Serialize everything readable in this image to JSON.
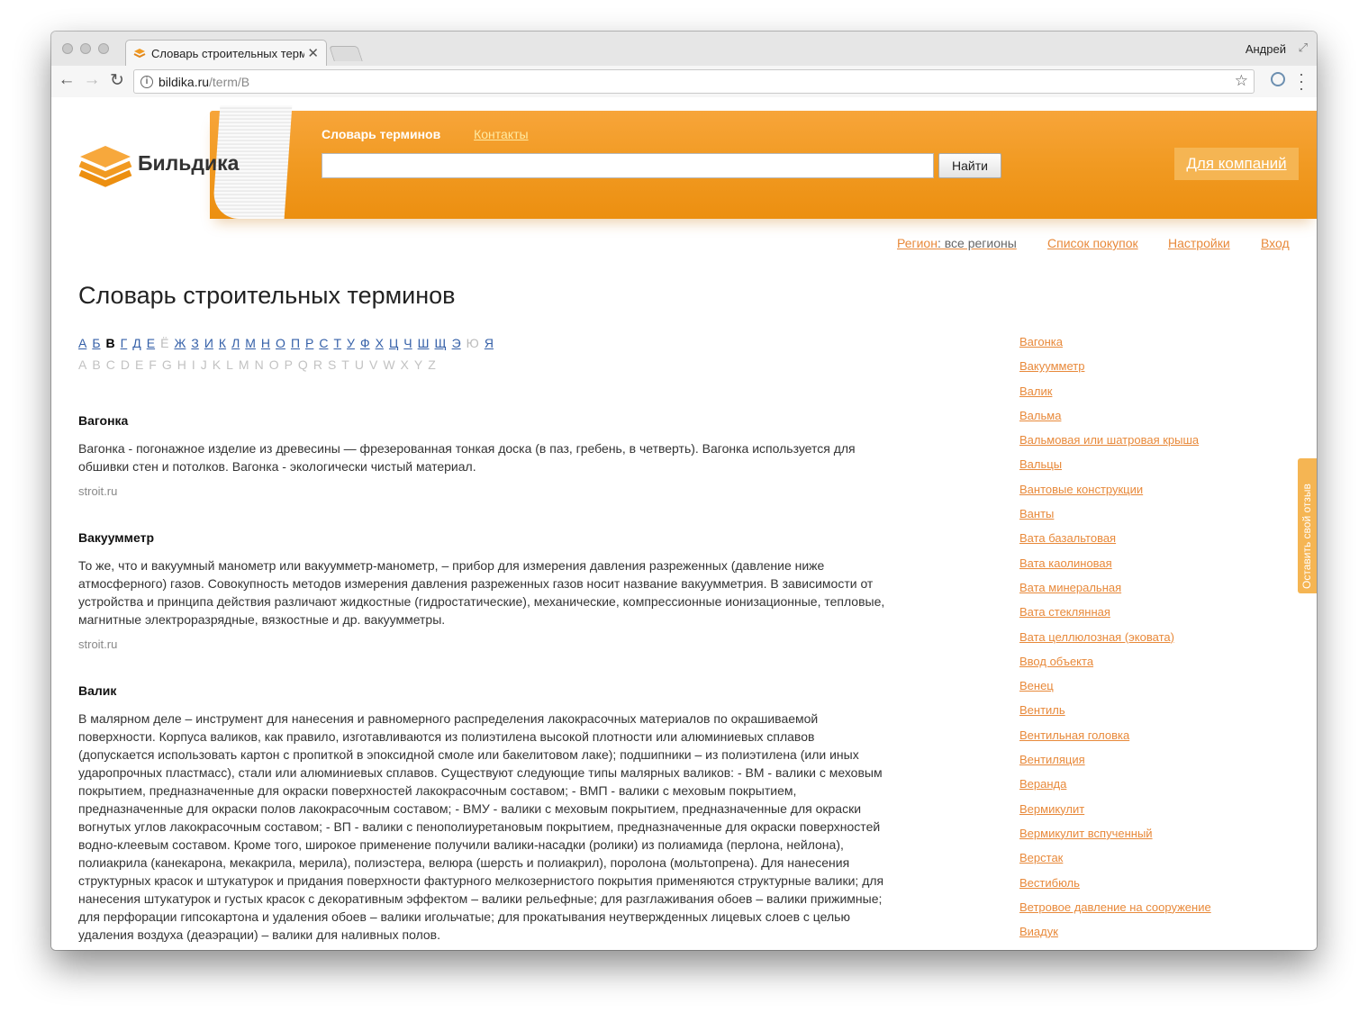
{
  "browser": {
    "tab_title": "Словарь строительных терм",
    "user": "Андрей",
    "url_host": "bildika.ru",
    "url_path": "/term/В"
  },
  "header": {
    "brand": "Бильдика",
    "nav_dictionary": "Словарь терминов",
    "nav_contacts": "Контакты",
    "search_button": "Найти",
    "search_value": "",
    "companies_button": "Для компаний",
    "accent": "#f19a22"
  },
  "util": {
    "region_label": "Регион",
    "region_value": ": все регионы",
    "shopping": "Список покупок",
    "settings": "Настройки",
    "login": "Вход"
  },
  "page_title": "Словарь строительных терминов",
  "alphabet_ru": [
    "А",
    "Б",
    "В",
    "Г",
    "Д",
    "Е",
    "Ё",
    "Ж",
    "З",
    "И",
    "К",
    "Л",
    "М",
    "Н",
    "О",
    "П",
    "Р",
    "С",
    "Т",
    "У",
    "Ф",
    "Х",
    "Ц",
    "Ч",
    "Ш",
    "Щ",
    "Э",
    "Ю",
    "Я"
  ],
  "alphabet_ru_current": "В",
  "alphabet_ru_disabled": [
    "Ё",
    "Ю"
  ],
  "alphabet_en": [
    "A",
    "B",
    "C",
    "D",
    "E",
    "F",
    "G",
    "H",
    "I",
    "J",
    "K",
    "L",
    "M",
    "N",
    "O",
    "P",
    "Q",
    "R",
    "S",
    "T",
    "U",
    "V",
    "W",
    "X",
    "Y",
    "Z"
  ],
  "entries": [
    {
      "title": "Вагонка",
      "text": "Вагонка - погонажное изделие из древесины — фрезерованная тонкая доска (в паз, гребень, в четверть). Вагонка используется для обшивки стен и потолков. Вагонка - экологически чистый материал.",
      "source": "stroit.ru"
    },
    {
      "title": "Вакуумметр",
      "text": "То же, что и вакуумный манометр или вакуумметр-манометр, – прибор для измерения давления разреженных (давление ниже атмосферного) газов. Совокупность методов измерения давления разреженных газов носит название вакуумметрия. В зависимости от устройства и принципа действия различают жидкостные (гидростатические), механические, компрессионные ионизационные, тепловые, магнитные электроразрядные, вязкостные и др. вакуумметры.",
      "source": "stroit.ru"
    },
    {
      "title": "Валик",
      "text": "В малярном деле – инструмент для нанесения и равномерного распределения лакокрасочных материалов по окрашиваемой поверхности. Корпуса валиков, как правило, изготавливаются из полиэтилена высокой плотности или алюминиевых сплавов (допускается использовать картон с пропиткой в эпоксидной смоле или бакелитовом лаке); подшипники – из полиэтилена (или иных ударопрочных пластмасс), стали или алюминиевых сплавов. Существуют следующие типы малярных валиков: - ВМ - валики с меховым покрытием, предназначенные для окраски поверхностей лакокрасочным составом; - ВМП - валики с меховым покрытием, предназначенные для окраски полов лакокрасочным составом; - ВМУ - валики с меховым покрытием, предназначенные для окраски вогнутых углов лакокрасочным составом; - ВП - валики с пенополиуретановым покрытием, предназначенные для окраски поверхностей водно-клеевым составом. Кроме того, широкое применение получили валики-насадки (ролики) из полиамида (перлона, нейлона), полиакрила (канекарона, мекакрила, мерила), полиэстера, велюра (шерсть и полиакрил), поролона (мольтопрена). Для нанесения структурных красок и штукатурок и придания поверхности фактурного мелкозернистого покрытия применяются структурные валики; для нанесения штукатурок и густых красок с декоративным эффектом – валики рельефные; для разглаживания обоев – валики прижимные; для перфорации гипсокартона и удаления обоев – валики игольчатые; для прокатывания неутвержденных лицевых слоев с целью удаления воздуха (деаэрации) – валики для наливных полов."
    }
  ],
  "sidebar": [
    "Вагонка",
    "Вакуумметр",
    "Валик",
    "Вальма",
    "Вальмовая или шатровая крыша",
    "Вальцы",
    "Вантовые конструкции",
    "Ванты",
    "Вата базальтовая",
    "Вата каолиновая",
    "Вата минеральная",
    "Вата стеклянная",
    "Вата целлюлозная (эковата)",
    "Ввод объекта",
    "Венец",
    "Вентиль",
    "Вентильная головка",
    "Вентиляция",
    "Веранда",
    "Вермикулит",
    "Вермикулит вспученный",
    "Верстак",
    "Вестибюль",
    "Ветровое давление на сооружение",
    "Виадук"
  ],
  "feedback": "Оставить свой отзыв"
}
